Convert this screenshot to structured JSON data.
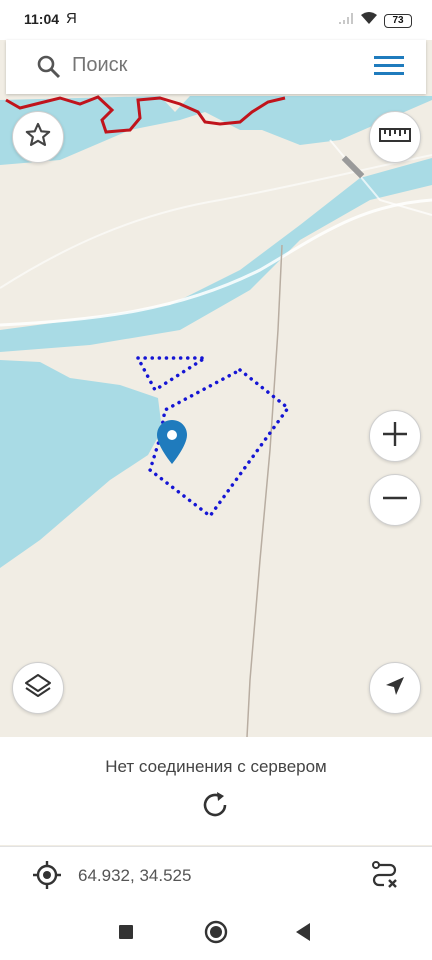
{
  "status_bar": {
    "time": "11:04",
    "carrier": "Я",
    "battery": "73",
    "icons": [
      "signal-icon",
      "wifi-icon",
      "battery-icon"
    ]
  },
  "search": {
    "placeholder": "Поиск",
    "icon": "search-icon",
    "menu_icon": "menu-icon"
  },
  "map": {
    "water_color": "#a9dbe5",
    "land_color": "#f1ede4",
    "border_color": "#c0141c",
    "track_color": "#1515d4",
    "marker_color": "#1f7bbd"
  },
  "map_controls": [
    "favorites-star-icon",
    "ruler-icon",
    "zoom-in-icon",
    "zoom-out-icon",
    "layers-icon",
    "navigation-arrow-icon"
  ],
  "status_panel": {
    "message": "Нет соединения с сервером",
    "refresh_icon": "refresh-icon"
  },
  "coordinates": {
    "value": "64.932, 34.525",
    "icon": "target-icon",
    "route_icon": "route-clear-icon"
  },
  "nav_bar": [
    "recents-square-icon",
    "home-circle-icon",
    "back-triangle-icon"
  ]
}
